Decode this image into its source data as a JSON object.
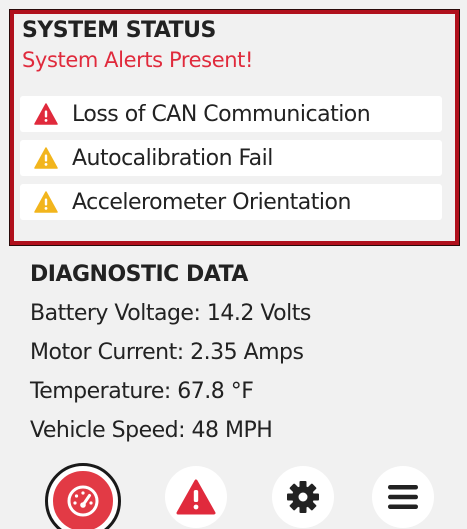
{
  "system_status": {
    "title": "SYSTEM STATUS",
    "subtitle": "System Alerts Present!",
    "alerts": [
      {
        "label": "Loss of CAN Communication",
        "severity": "critical",
        "icon": "warning-red-icon",
        "color": "#e02a3c"
      },
      {
        "label": "Autocalibration Fail",
        "severity": "warning",
        "icon": "warning-yellow-icon",
        "color": "#f2b51d"
      },
      {
        "label": "Accelerometer Orientation",
        "severity": "warning",
        "icon": "warning-yellow-icon",
        "color": "#f2b51d"
      }
    ],
    "border_color": "#b0101c"
  },
  "diagnostic_data": {
    "title": "DIAGNOSTIC DATA",
    "lines": [
      "Battery Voltage: 14.2 Volts",
      "Motor Current: 2.35 Amps",
      "Temperature: 67.8 °F",
      "Vehicle Speed: 48 MPH"
    ]
  },
  "bottom_nav": {
    "items": [
      {
        "icon": "dashboard-gauge-icon",
        "active": true,
        "color": "#e23a45"
      },
      {
        "icon": "alert-triangle-icon",
        "active": false,
        "color": "#e02a3c"
      },
      {
        "icon": "gear-icon",
        "active": false,
        "color": "#222222"
      },
      {
        "icon": "hamburger-menu-icon",
        "active": false,
        "color": "#222222"
      }
    ]
  }
}
